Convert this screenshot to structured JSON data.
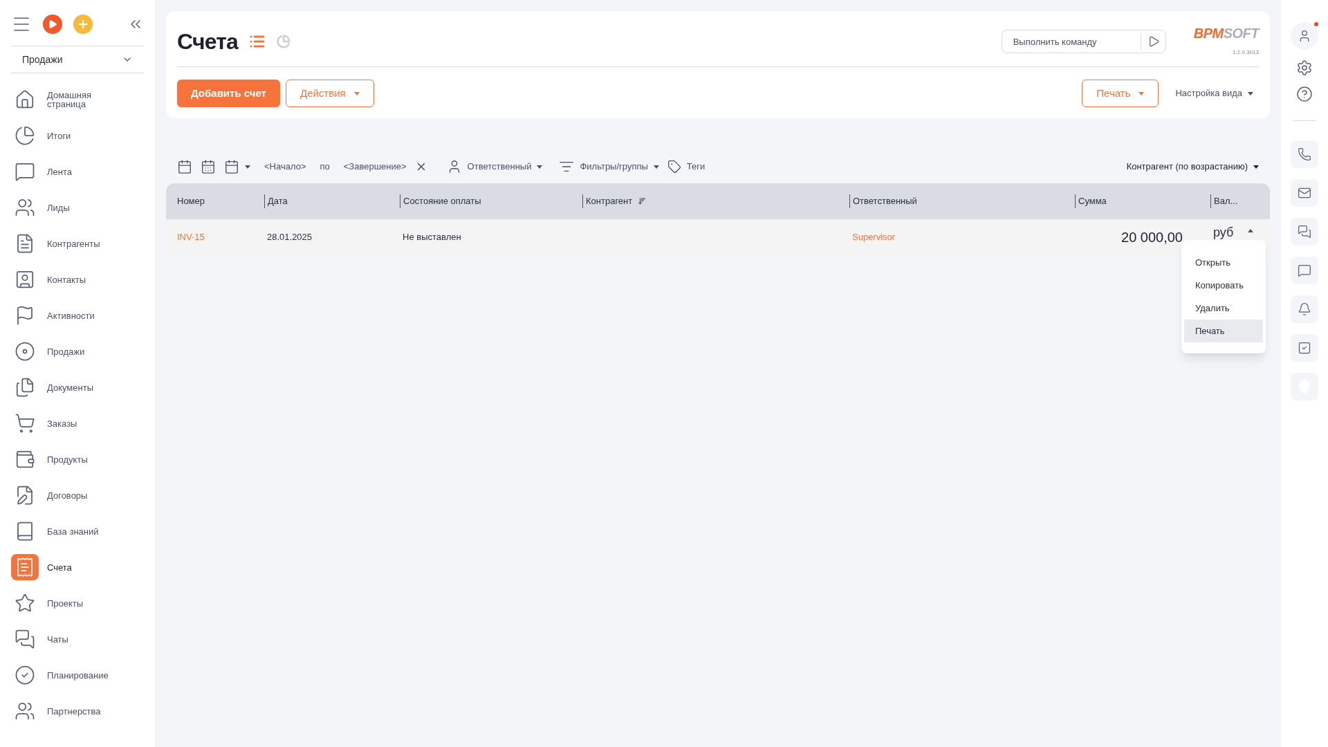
{
  "sidebar": {
    "section_select": "Продажи",
    "items": [
      {
        "label": "Домашняя страница",
        "selected": false
      },
      {
        "label": "Итоги",
        "selected": false
      },
      {
        "label": "Лента",
        "selected": false
      },
      {
        "label": "Лиды",
        "selected": false
      },
      {
        "label": "Контрагенты",
        "selected": false
      },
      {
        "label": "Контакты",
        "selected": false
      },
      {
        "label": "Активности",
        "selected": false
      },
      {
        "label": "Продажи",
        "selected": false
      },
      {
        "label": "Документы",
        "selected": false
      },
      {
        "label": "Заказы",
        "selected": false
      },
      {
        "label": "Продукты",
        "selected": false
      },
      {
        "label": "Договоры",
        "selected": false
      },
      {
        "label": "База знаний",
        "selected": false
      },
      {
        "label": "Счета",
        "selected": true
      },
      {
        "label": "Проекты",
        "selected": false
      },
      {
        "label": "Чаты",
        "selected": false
      },
      {
        "label": "Планирование",
        "selected": false
      },
      {
        "label": "Партнерства",
        "selected": false
      }
    ]
  },
  "header": {
    "title": "Счета",
    "view_list_selected": true,
    "command": {
      "placeholder": "Выполнить команду"
    },
    "logo": {
      "part_1": "BPM",
      "part_2": "SOFT"
    },
    "version": "1.2.0.3013"
  },
  "toolbar": {
    "add_button": "Добавить счет",
    "actions_button": "Действия",
    "print_button": "Печать",
    "view_settings": "Настройка вида"
  },
  "filters": {
    "start": "<Начало>",
    "to": "по",
    "end": "<Завершение>",
    "owner": "Ответственный",
    "filters": "Фильтры/группы",
    "tags": "Теги",
    "sort": "Контрагент (по возрастанию)"
  },
  "table": {
    "columns": [
      "Номер",
      "Дата",
      "Состояние оплаты",
      "Контрагент",
      "Ответственный",
      "Сумма",
      "Вал..."
    ],
    "rows": [
      {
        "number": "INV-15",
        "date": "28.01.2025",
        "status": "Не выставлен",
        "account": "",
        "owner": "Supervisor",
        "amount": "20 000,00",
        "currency": "руб"
      }
    ]
  },
  "context_menu": [
    {
      "label": "Открыть",
      "selected": false
    },
    {
      "label": "Копировать",
      "selected": false
    },
    {
      "label": "Удалить",
      "selected": false
    },
    {
      "label": "Печать",
      "selected": true
    }
  ],
  "right_bar": {
    "notification": true
  }
}
